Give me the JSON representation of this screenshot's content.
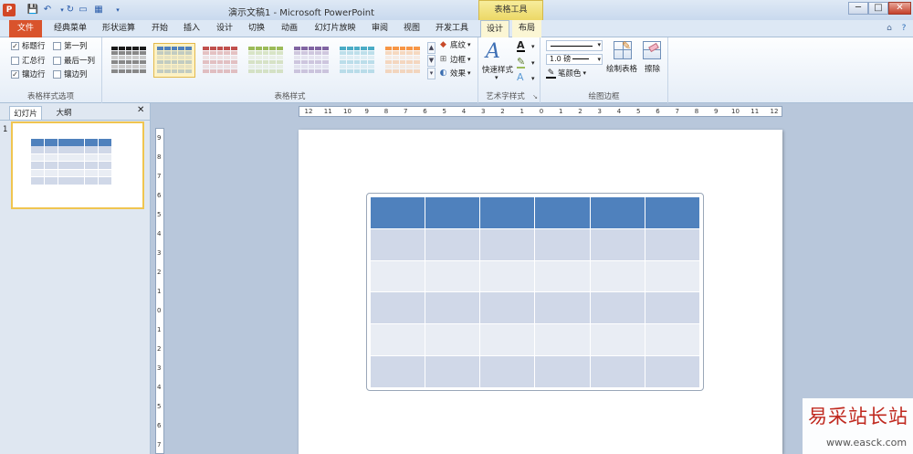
{
  "title_bar": {
    "app_icon": "P",
    "document_title": "演示文稿1 - Microsoft PowerPoint",
    "context_tool": "表格工具",
    "qat": [
      "save-icon",
      "undo-icon",
      "redo-icon",
      "layout-icon",
      "table-icon",
      "dropdown-icon"
    ]
  },
  "window_controls": {
    "minimize": "─",
    "maximize": "□",
    "close": "✕"
  },
  "tabs": {
    "file": "文件",
    "classic_menu": "经典菜单",
    "shape_ops": "形状运算",
    "home": "开始",
    "insert": "插入",
    "design_main": "设计",
    "transitions": "切换",
    "animations": "动画",
    "slideshow": "幻灯片放映",
    "review": "审阅",
    "view": "视图",
    "developer": "开发工具",
    "design": "设计",
    "layout": "布局"
  },
  "ribbon": {
    "table_style_options": {
      "header_row": "标题行",
      "first_column": "第一列",
      "total_row": "汇总行",
      "last_column": "最后一列",
      "banded_rows": "镶边行",
      "banded_columns": "镶边列",
      "label": "表格样式选项"
    },
    "table_styles": {
      "label": "表格样式",
      "shading": "底纹",
      "borders": "边框",
      "effects": "效果",
      "thumb_colors": [
        "#1a1a1a",
        "#4f81bd",
        "#c0504d",
        "#9bbb59",
        "#8064a2",
        "#4bacc6",
        "#f79646"
      ]
    },
    "wordart": {
      "quick_styles": "快速样式",
      "label": "艺术字样式"
    },
    "draw_borders": {
      "pen_weight": "1.0 磅",
      "pen_color": "笔颜色",
      "draw_table": "绘制表格",
      "eraser": "擦除",
      "label": "绘图边框"
    }
  },
  "left_pane": {
    "tab_slides": "幻灯片",
    "tab_outline": "大纲",
    "slide_number": "1",
    "close": "✕"
  },
  "ruler": {
    "h_ticks": [
      "12",
      "11",
      "10",
      "9",
      "8",
      "7",
      "6",
      "5",
      "4",
      "3",
      "2",
      "1",
      "0",
      "1",
      "2",
      "3",
      "4",
      "5",
      "6",
      "7",
      "8",
      "9",
      "10",
      "11",
      "12"
    ],
    "v_ticks": [
      "9",
      "8",
      "7",
      "6",
      "5",
      "4",
      "3",
      "2",
      "1",
      "0",
      "1",
      "2",
      "3",
      "4",
      "5",
      "6",
      "7"
    ]
  },
  "table": {
    "rows": 6,
    "columns": 6,
    "header_color": "#4f81bd",
    "band_dark": "#d0d8e8",
    "band_light": "#e9edf4"
  },
  "watermark": {
    "title": "易采站长站",
    "url": "www.easck.com"
  }
}
